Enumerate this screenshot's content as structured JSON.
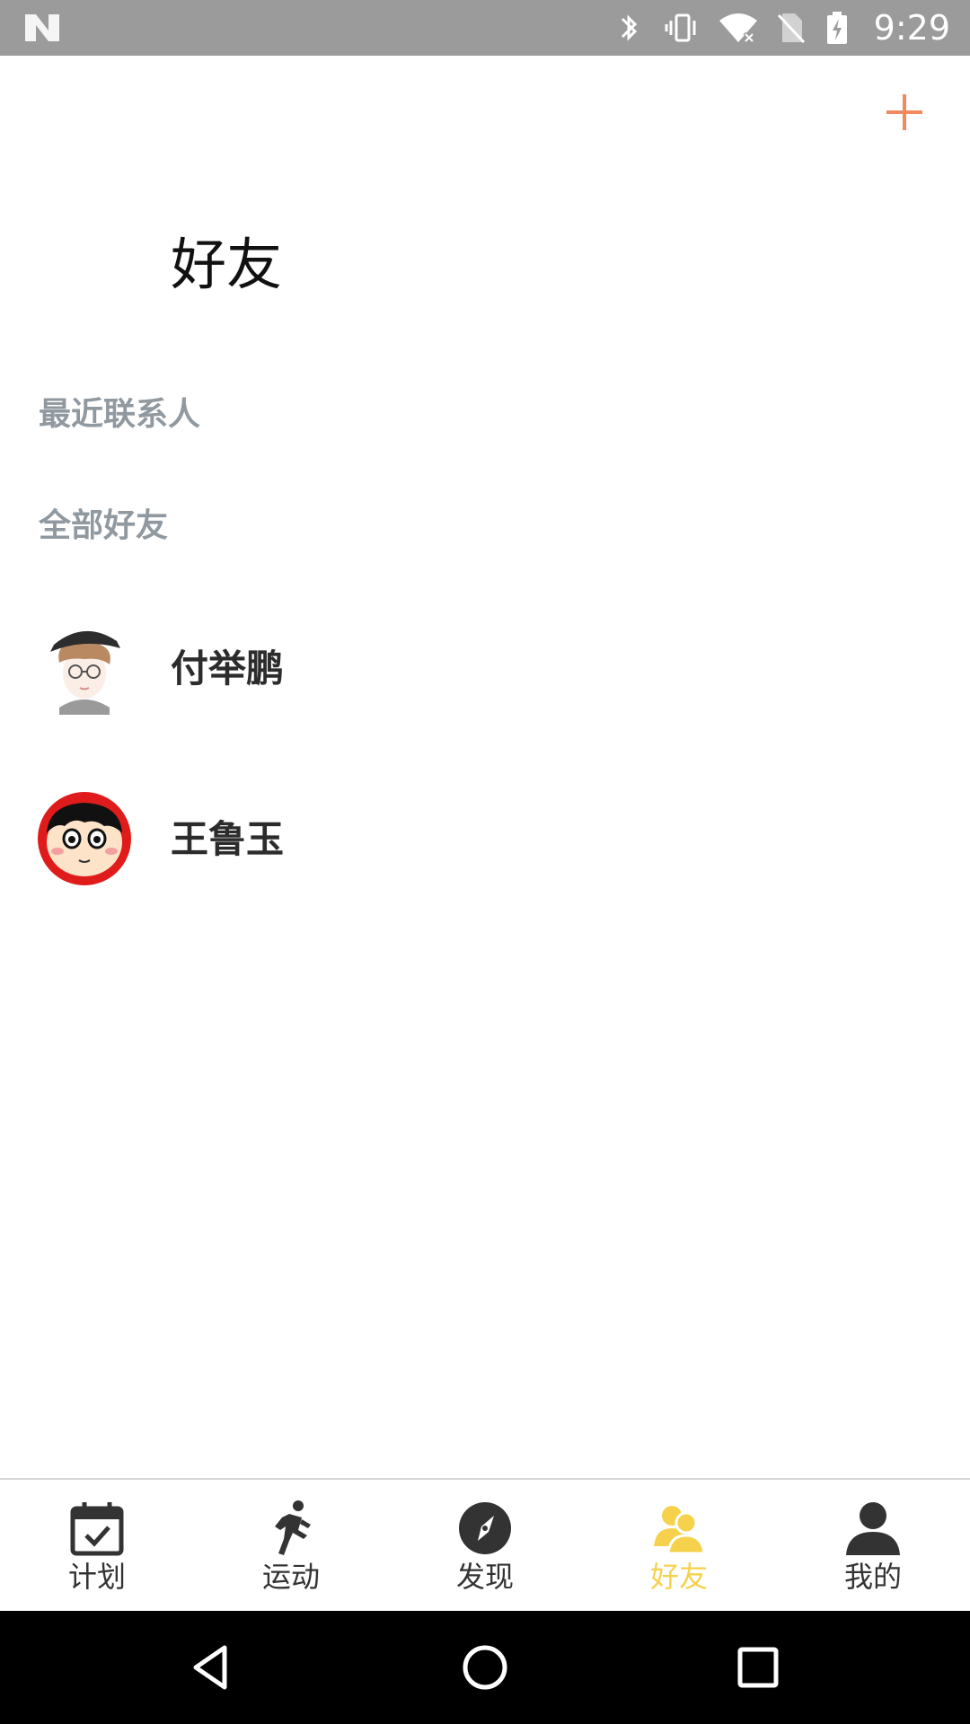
{
  "status_bar": {
    "time": "9:29",
    "icons": [
      "n-logo-icon",
      "bluetooth-icon",
      "vibrate-icon",
      "wifi-off-icon",
      "no-sim-icon",
      "battery-charging-icon"
    ],
    "background": "#9b9b9b"
  },
  "header": {
    "title": "好友",
    "add_icon": "plus-icon",
    "accent_color": "#f08a5d"
  },
  "sections": {
    "recent_title": "最近联系人",
    "all_title": "全部好友"
  },
  "friends": [
    {
      "name": "付举鹏",
      "avatar": "cartoon-boy-cap-glasses"
    },
    {
      "name": "王鲁玉",
      "avatar": "cartoon-crayon-shinchan"
    }
  ],
  "tabs": [
    {
      "label": "计划",
      "icon": "calendar-check-icon",
      "active": false
    },
    {
      "label": "运动",
      "icon": "running-icon",
      "active": false
    },
    {
      "label": "发现",
      "icon": "compass-icon",
      "active": false
    },
    {
      "label": "好友",
      "icon": "friends-icon",
      "active": true
    },
    {
      "label": "我的",
      "icon": "user-icon",
      "active": false
    }
  ],
  "tab_colors": {
    "active": "#f6d24c",
    "inactive": "#333333"
  },
  "nav_bar": {
    "buttons": [
      "back-icon",
      "home-icon",
      "recents-icon"
    ]
  }
}
